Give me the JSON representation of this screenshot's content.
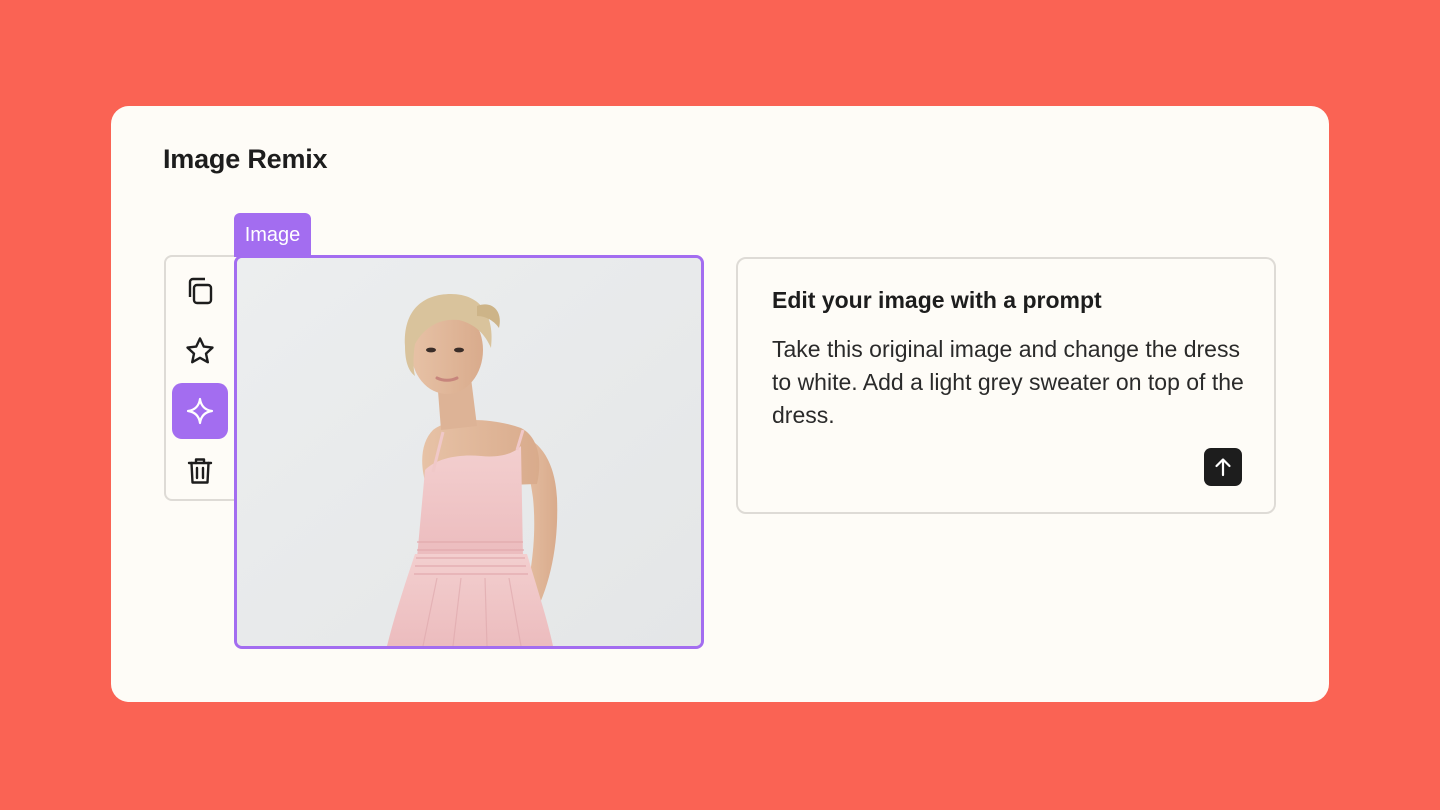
{
  "card": {
    "title": "Image Remix"
  },
  "toolbar": {
    "items": [
      {
        "icon": "copy-icon",
        "active": false
      },
      {
        "icon": "star-icon",
        "active": false
      },
      {
        "icon": "sparkle-icon",
        "active": true
      },
      {
        "icon": "trash-icon",
        "active": false
      }
    ]
  },
  "image": {
    "tag_label": "Image"
  },
  "prompt": {
    "title": "Edit your image with a prompt",
    "text": "Take this original image and change the dress to white. Add a light grey sweater on top of the dress.",
    "send_icon": "arrow-up-icon"
  },
  "colors": {
    "background": "#fa6354",
    "card": "#fefcf7",
    "accent": "#a36df0",
    "text": "#1d1d1d",
    "border": "#dedbd6"
  }
}
